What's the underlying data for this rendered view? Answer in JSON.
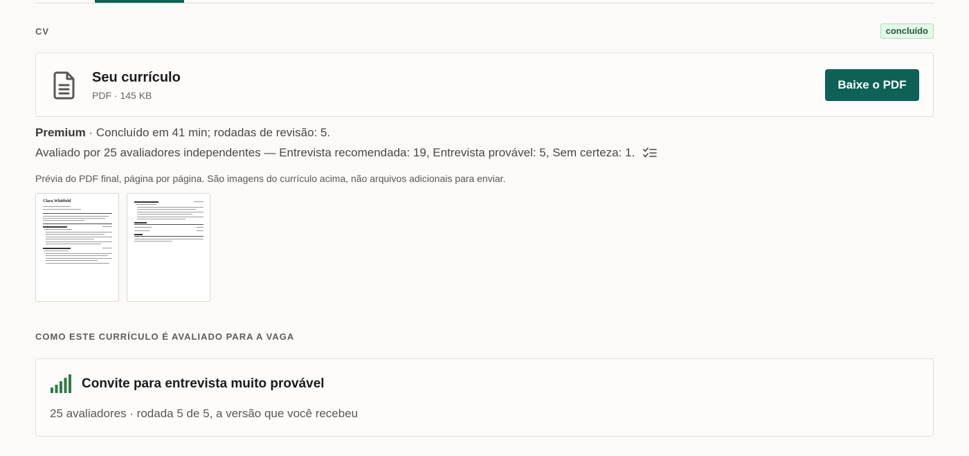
{
  "tabs": {
    "active_indicator": true
  },
  "cv_section": {
    "label": "CV",
    "status_badge": "concluído"
  },
  "file_card": {
    "icon": "document-icon",
    "title": "Seu currículo",
    "meta": "PDF · 145 KB",
    "download_label": "Baixe o PDF"
  },
  "summary": {
    "tier": "Premium",
    "details": " · Concluído em 41 min; rodadas de revisão: 5."
  },
  "evaluation_line": {
    "text": "Avaliado por 25 avaliadores independentes — Entrevista recomendada: 19, Entrevista provável: 5, Sem certeza: 1.",
    "icon": "checklist-icon"
  },
  "preview": {
    "caption": "Prévia do PDF final, página por página. São imagens do currículo acima, não arquivos adicionais para enviar.",
    "pages": [
      {
        "name": "Clara Whitfield"
      },
      {
        "name": ""
      }
    ]
  },
  "assessment_section": {
    "label": "COMO ESTE CURRÍCULO É AVALIADO PARA A VAGA",
    "icon": "signal-bars-icon",
    "title": "Convite para entrevista muito provável",
    "meta": "25 avaliadores · rodada 5 de 5, a versão que você recebeu"
  },
  "colors": {
    "accent": "#0e6155",
    "badge_bg": "#e7f7eb",
    "badge_border": "#a6dfb4",
    "bars": "#2f7a45"
  }
}
